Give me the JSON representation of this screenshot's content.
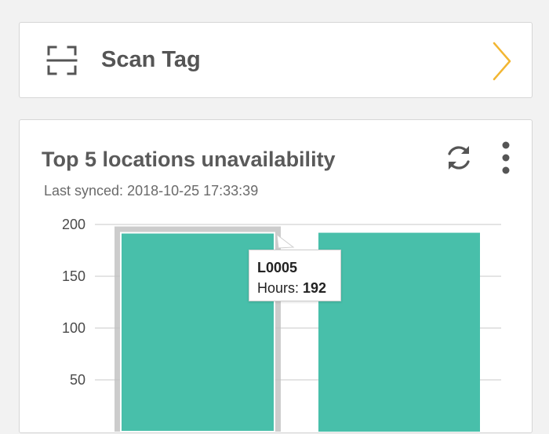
{
  "scan": {
    "label": "Scan Tag",
    "icon": "scan-frame-icon",
    "chevron_color": "#f2b632"
  },
  "chart_card": {
    "title": "Top 5 locations unavailability",
    "synced_label": "Last synced:",
    "synced_value": "2018-10-25 17:33:39",
    "refresh_icon": "refresh-icon",
    "menu_icon": "more-vert-icon"
  },
  "tooltip": {
    "title": "L0005",
    "metric_label": "Hours:",
    "metric_value": "192"
  },
  "colors": {
    "bar": "#48bfaa",
    "accent": "#f2b632"
  },
  "chart_data": {
    "type": "bar",
    "categories": [
      "L0005",
      ""
    ],
    "values": [
      192,
      192
    ],
    "ytick_labels": [
      "200",
      "150",
      "100",
      "50"
    ],
    "yticks": [
      200,
      150,
      100,
      50
    ],
    "ylim": [
      0,
      200
    ],
    "grid": true,
    "highlighted_index": 0
  }
}
